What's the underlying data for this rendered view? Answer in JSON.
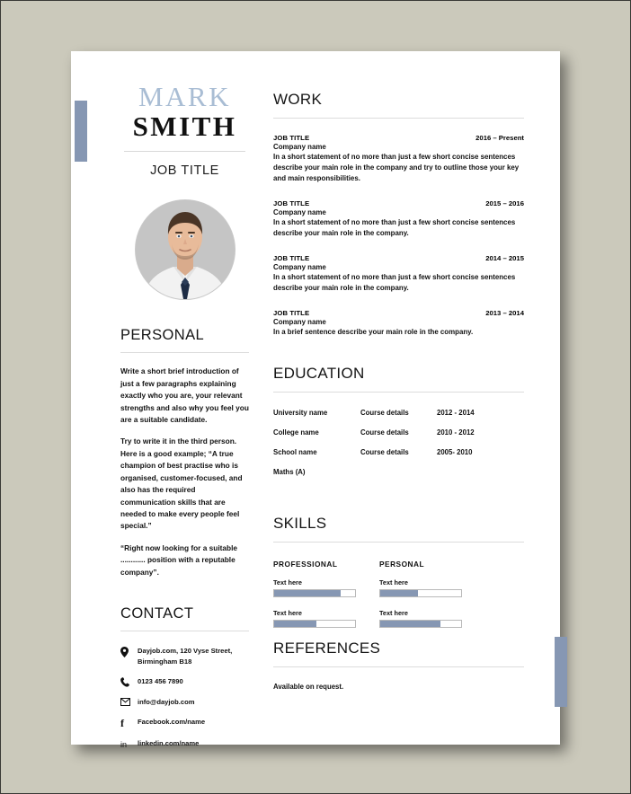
{
  "theme": {
    "accent": "#8697b3",
    "first_name_color": "#a9bdd4",
    "page_bg": "#cbc9bb"
  },
  "header": {
    "first_name": "MARK",
    "last_name": "SMITH",
    "job_title": "JOB TITLE",
    "photo_icon": "portrait-photo"
  },
  "left": {
    "personal": {
      "heading": "PERSONAL",
      "paragraphs": [
        "Write a short brief introduction of just a few paragraphs explaining exactly who you are, your relevant strengths and also why you feel you are a suitable candidate.",
        "Try to write it in the third person. Here is a good example; “A true champion of best practise who is organised, customer-focused, and also has the required communication skills that are needed to make every people feel special.”",
        "“Right now looking for a suitable ............ position with a reputable company”."
      ]
    },
    "contact": {
      "heading": "CONTACT",
      "items": [
        {
          "icon": "location-pin-icon",
          "text": "Dayjob.com, 120 Vyse Street, Birmingham B18"
        },
        {
          "icon": "phone-icon",
          "text": "0123 456 7890"
        },
        {
          "icon": "envelope-icon",
          "text": "info@dayjob.com"
        },
        {
          "icon": "facebook-icon",
          "text": "Facebook.com/name"
        },
        {
          "icon": "linkedin-icon",
          "text": "linkedin.com/name"
        }
      ]
    }
  },
  "right": {
    "work": {
      "heading": "WORK",
      "jobs": [
        {
          "title": "JOB TITLE",
          "date": "2016 – Present",
          "company": "Company name",
          "description": "In a short statement of no more than just a few short concise sentences describe your main role in the company and try to outline those your key and main responsibilities."
        },
        {
          "title": "JOB TITLE",
          "date": "2015 – 2016",
          "company": "Company name",
          "description": "In a short statement of no more than just a few short concise sentences describe your main role in the company."
        },
        {
          "title": "JOB TITLE",
          "date": "2014 – 2015",
          "company": "Company name",
          "description": "In a short statement of no more than just a few short concise sentences describe your main role in the company."
        },
        {
          "title": "JOB TITLE",
          "date": "2013 – 2014",
          "company": "Company name",
          "description": "In a brief sentence describe your main role in the company."
        }
      ]
    },
    "education": {
      "heading": "EDUCATION",
      "rows": [
        {
          "institution": "University name",
          "course": "Course details",
          "date": "2012 - 2014"
        },
        {
          "institution": "College name",
          "course": "Course details",
          "date": "2010 - 2012"
        },
        {
          "institution": "School name",
          "course": "Course details",
          "date": "2005- 2010"
        },
        {
          "institution": "Maths (A)",
          "course": "",
          "date": ""
        }
      ]
    },
    "skills": {
      "heading": "SKILLS",
      "columns": [
        {
          "title": "PROFESSIONAL",
          "items": [
            {
              "label": "Text here",
              "value": 82
            },
            {
              "label": "Text here",
              "value": 52
            }
          ]
        },
        {
          "title": "PERSONAL",
          "items": [
            {
              "label": "Text here",
              "value": 47
            },
            {
              "label": "Text here",
              "value": 74
            }
          ]
        }
      ]
    },
    "references": {
      "heading": "REFERENCES",
      "text": "Available on request."
    }
  }
}
